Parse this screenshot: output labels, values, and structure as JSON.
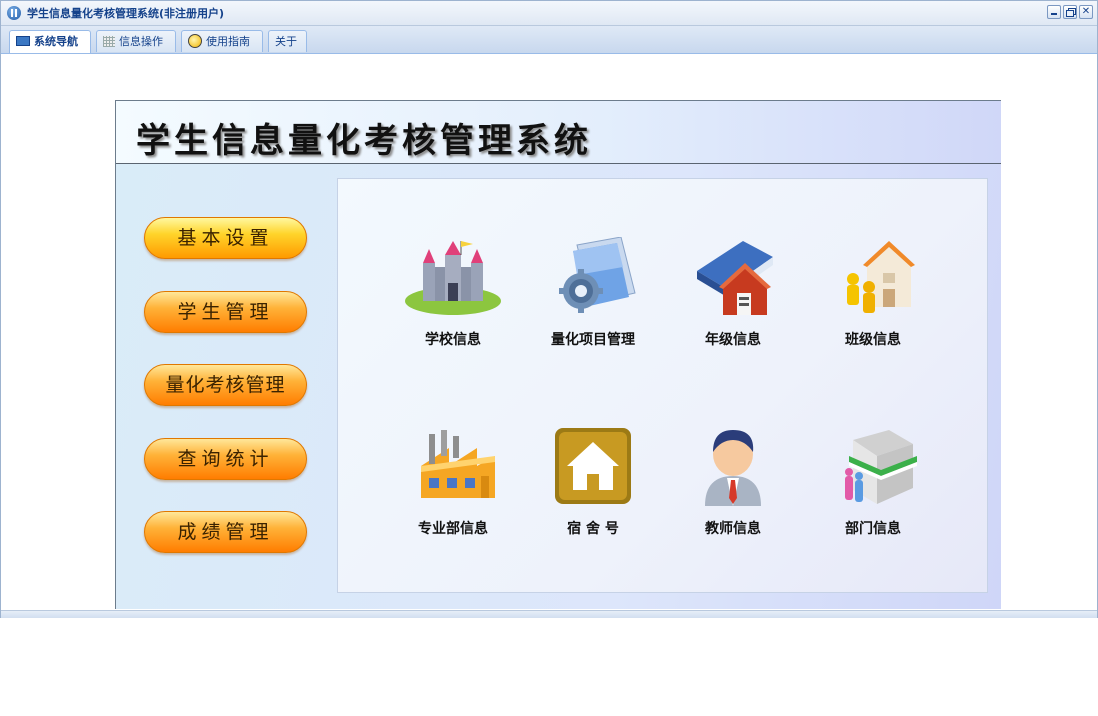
{
  "window": {
    "title": "学生信息量化考核管理系统(非注册用户)"
  },
  "tabs": [
    {
      "label": "系统导航",
      "icon": "monitor-icon"
    },
    {
      "label": "信息操作",
      "icon": "grid-icon"
    },
    {
      "label": "使用指南",
      "icon": "guide-icon"
    },
    {
      "label": "关于",
      "icon": ""
    }
  ],
  "system": {
    "title": "学生信息量化考核管理系统",
    "menu": [
      {
        "label": "基本设置"
      },
      {
        "label": "学生管理"
      },
      {
        "label": "量化考核管理"
      },
      {
        "label": "查询统计"
      },
      {
        "label": "成绩管理"
      }
    ],
    "tiles": [
      {
        "label": "学校信息",
        "icon": "castle-icon"
      },
      {
        "label": "量化项目管理",
        "icon": "folder-gear-icon"
      },
      {
        "label": "年级信息",
        "icon": "books-icon"
      },
      {
        "label": "班级信息",
        "icon": "class-house-icon"
      },
      {
        "label": "专业部信息",
        "icon": "factory-icon"
      },
      {
        "label": "宿 舍 号",
        "icon": "house-icon"
      },
      {
        "label": "教师信息",
        "icon": "teacher-icon"
      },
      {
        "label": "部门信息",
        "icon": "shop-icon"
      }
    ]
  },
  "colors": {
    "accent": "#15428b",
    "button_yellow": "#ffd42a",
    "button_orange": "#ff8a00"
  }
}
